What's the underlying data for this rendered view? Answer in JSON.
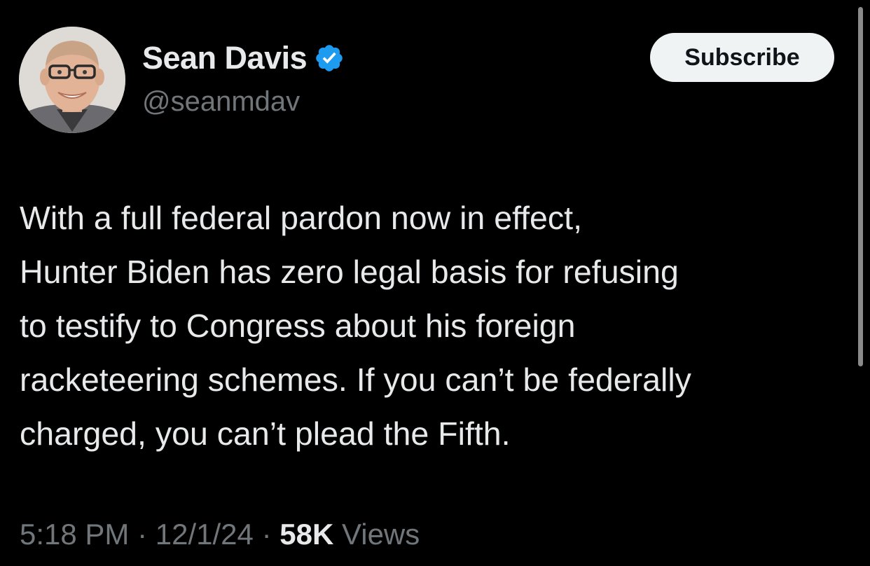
{
  "author": {
    "display_name": "Sean Davis",
    "handle": "@seanmdav",
    "verified_icon": "verified-badge-icon",
    "avatar_icon": "profile-photo"
  },
  "subscribe_label": "Subscribe",
  "tweet": {
    "lines": [
      "With a full federal pardon now in effect,",
      "Hunter Biden has zero legal basis for refusing",
      "to testify to Congress about his foreign",
      "racketeering schemes. If you can’t be federally",
      "charged, you can’t plead the Fifth."
    ]
  },
  "meta": {
    "time": "5:18 PM",
    "separator": "·",
    "date": "12/1/24",
    "views_count": "58K",
    "views_label": "Views"
  },
  "colors": {
    "background": "#000000",
    "text_primary": "#e7e9ea",
    "text_secondary": "#71767b",
    "verified_blue": "#1d9bf0",
    "button_bg": "#eff3f4"
  }
}
